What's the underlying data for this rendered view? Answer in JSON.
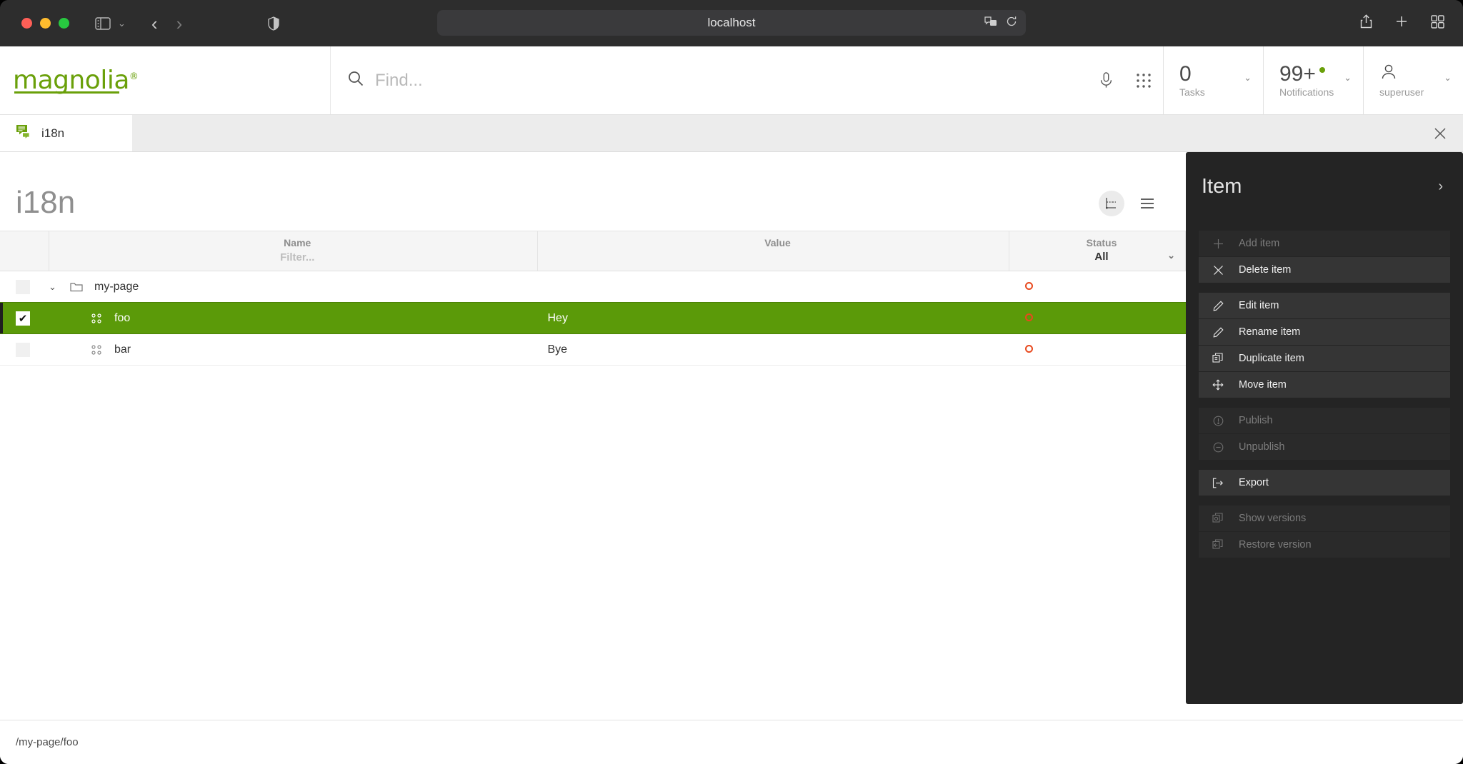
{
  "browser": {
    "url": "localhost",
    "icons": {
      "sidebar": "sidebar-icon",
      "back": "back-arrow-icon",
      "forward": "forward-arrow-icon",
      "shield": "privacy-shield-icon",
      "translate": "translate-icon",
      "reload": "reload-icon",
      "share": "share-icon",
      "new_tab": "plus-icon",
      "tab_overview": "tab-overview-icon"
    }
  },
  "header": {
    "logo_text": "magnolia",
    "logo_tm": "®",
    "search_placeholder": "Find...",
    "search_value": "",
    "mic_icon": "microphone-icon",
    "apps_icon": "apps-grid-icon",
    "tasks": {
      "count": "0",
      "label": "Tasks"
    },
    "notifications": {
      "count": "99+",
      "label": "Notifications"
    },
    "user": {
      "name": "superuser",
      "icon": "user-icon"
    }
  },
  "tabs": {
    "items": [
      {
        "label": "i18n",
        "icon": "i18n-speech-bubble-icon",
        "active": true
      }
    ],
    "close_label": "✕"
  },
  "main": {
    "page_title": "i18n",
    "view_toggles": [
      {
        "name": "tree-view-toggle",
        "icon": "tree-view-icon",
        "active": true
      },
      {
        "name": "list-view-toggle",
        "icon": "list-view-icon",
        "active": false
      }
    ],
    "table": {
      "columns": [
        {
          "key": "check",
          "label": ""
        },
        {
          "key": "name",
          "label": "Name",
          "filter_placeholder": "Filter..."
        },
        {
          "key": "value",
          "label": "Value"
        },
        {
          "key": "status",
          "label": "Status",
          "selected": "All"
        }
      ],
      "rows": [
        {
          "name": "my-page",
          "value": "",
          "status": "unpublished",
          "type": "folder",
          "icon": "folder-icon",
          "expanded": true,
          "selected": false,
          "checked": false,
          "indent": 0
        },
        {
          "name": "foo",
          "value": "Hey",
          "status": "unpublished",
          "type": "item",
          "icon": "content-node-icon",
          "expanded": false,
          "selected": true,
          "checked": true,
          "indent": 1
        },
        {
          "name": "bar",
          "value": "Bye",
          "status": "unpublished",
          "type": "item",
          "icon": "content-node-icon",
          "expanded": false,
          "selected": false,
          "checked": false,
          "indent": 1
        }
      ]
    }
  },
  "action_panel": {
    "title": "Item",
    "collapse_icon": "chevron-right-icon",
    "groups": [
      {
        "actions": [
          {
            "label": "Add item",
            "icon": "plus-icon",
            "enabled": false
          },
          {
            "label": "Delete item",
            "icon": "close-x-icon",
            "enabled": true
          }
        ]
      },
      {
        "actions": [
          {
            "label": "Edit item",
            "icon": "pencil-icon",
            "enabled": true
          },
          {
            "label": "Rename item",
            "icon": "pencil-icon",
            "enabled": true
          },
          {
            "label": "Duplicate item",
            "icon": "duplicate-icon",
            "enabled": true
          },
          {
            "label": "Move item",
            "icon": "move-arrows-icon",
            "enabled": true
          }
        ]
      },
      {
        "actions": [
          {
            "label": "Publish",
            "icon": "publish-circle-icon",
            "enabled": false
          },
          {
            "label": "Unpublish",
            "icon": "unpublish-minus-circle-icon",
            "enabled": false
          }
        ]
      },
      {
        "actions": [
          {
            "label": "Export",
            "icon": "export-icon",
            "enabled": true
          }
        ]
      },
      {
        "actions": [
          {
            "label": "Show versions",
            "icon": "show-versions-icon",
            "enabled": false
          },
          {
            "label": "Restore version",
            "icon": "restore-version-icon",
            "enabled": false
          }
        ]
      }
    ]
  },
  "statusbar": {
    "path": "/my-page/foo"
  },
  "colors": {
    "brand_green": "#6aa00a",
    "selection_green": "#5b9a09",
    "status_unpublished": "#e8491e",
    "panel_bg": "#242424"
  }
}
